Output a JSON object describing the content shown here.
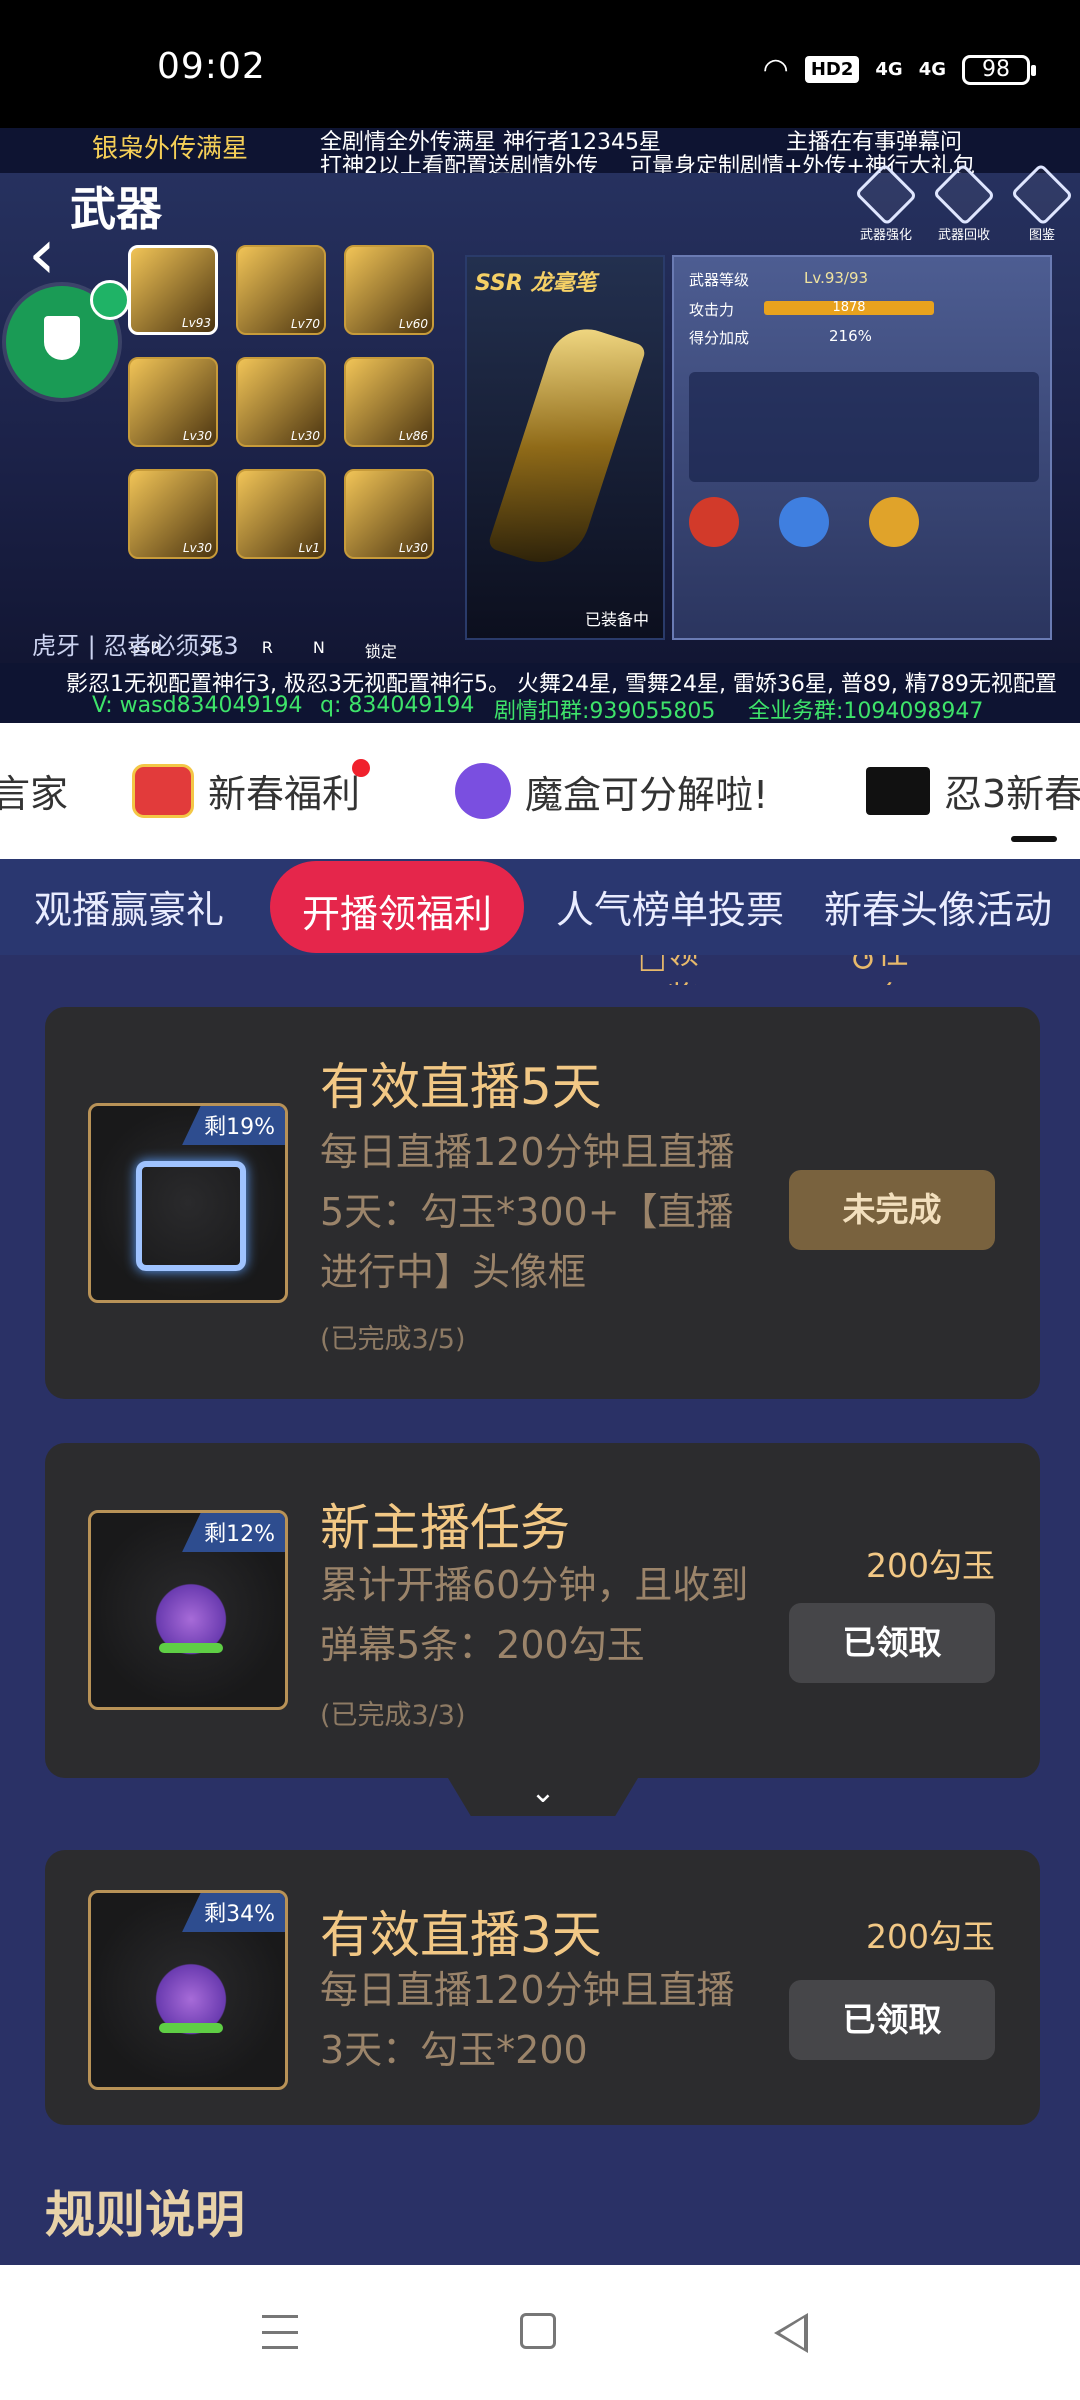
{
  "status_bar": {
    "time": "09:02",
    "hd_badge": "HD2",
    "net1": "4G",
    "net2": "4G",
    "battery": "98"
  },
  "stream": {
    "top_left": "银枭外传满星",
    "top_mid_1": "全剧情全外传满星  神行者12345星",
    "top_mid_2": "打神2以上看配置送剧情外传",
    "top_right_1": "主播在有事弹幕问",
    "top_right_2": "可量身定制剧情+外传+神行大礼包",
    "game_title": "武器",
    "tools": [
      "武器强化",
      "武器回收",
      "图鉴"
    ],
    "weapon_name": "SSR 龙毫笔",
    "stat_labels": [
      "武器等级",
      "攻击力",
      "得分加成"
    ],
    "stat_values": [
      "Lv.93/93",
      "1878",
      "216%"
    ],
    "equipped": "已装备中",
    "filters": [
      "SSR",
      "SS",
      "R",
      "N",
      "锁定"
    ],
    "bottom_left": "虎牙 | 忍者必须死3",
    "bottom_line": "影忍1无视配置神行3, 极忍3无视配置神行5。     火舞24星, 雪舞24星, 雷娇36星, 普89, 精789无视配置",
    "contact_v": "V: wasd834049194",
    "contact_q": "q: 834049194",
    "group1": "剧情扣群:939055805",
    "group2": "全业务群:1094098947"
  },
  "tabs": [
    {
      "label": "言家"
    },
    {
      "label": "新春福利",
      "badge": true
    },
    {
      "label": "魔盒可分解啦!"
    },
    {
      "label": "忍3新春"
    }
  ],
  "subtabs": [
    "观播赢豪礼",
    "开播领福利",
    "人气榜单投票",
    "新春头像活动"
  ],
  "links": {
    "records": "领奖记录",
    "status": "任务状态"
  },
  "tasks": [
    {
      "remain": "剩19%",
      "title": "有效直播5天",
      "desc": "每日直播120分钟且直播5天：勾玉*300+【直播进行中】头像框",
      "progress": "(已完成3/5)",
      "reward": "",
      "button": "未完成"
    },
    {
      "remain": "剩12%",
      "title": "新主播任务",
      "desc": "累计开播60分钟，且收到弹幕5条：200勾玉",
      "progress": "(已完成3/3)",
      "reward": "200勾玉",
      "button": "已领取"
    },
    {
      "remain": "剩34%",
      "title": "有效直播3天",
      "desc": "每日直播120分钟且直播3天：勾玉*200",
      "progress": "",
      "reward": "200勾玉",
      "button": "已领取"
    }
  ],
  "rules_title": "规则说明",
  "colors": {
    "accent": "#e5264b",
    "gold": "#f2c885",
    "page_bg": "#2a3166",
    "card_bg": "#2c2c2e"
  }
}
